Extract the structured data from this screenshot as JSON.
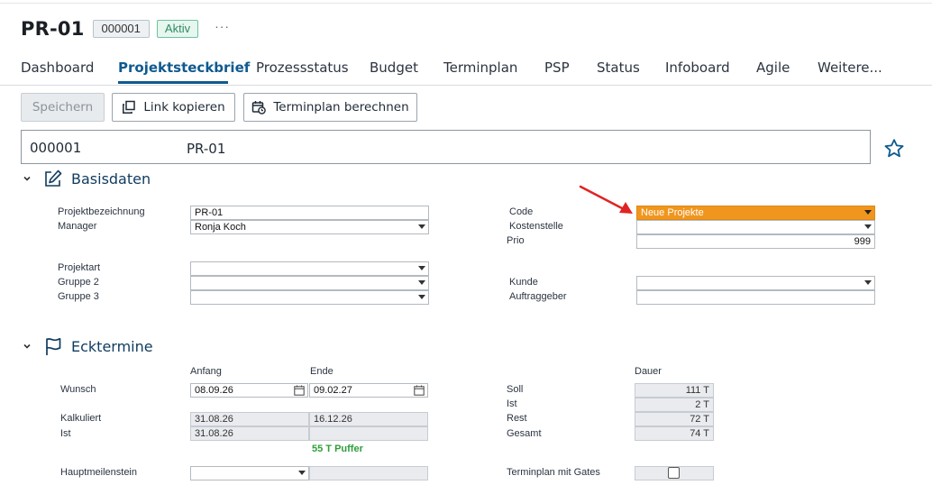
{
  "header": {
    "title": "PR-01",
    "id_badge": "000001",
    "status_badge": "Aktiv",
    "more": "···"
  },
  "tabs": [
    {
      "label": "Dashboard"
    },
    {
      "label": "Projektsteckbrief",
      "active": true
    },
    {
      "label": "Prozessstatus"
    },
    {
      "label": "Budget"
    },
    {
      "label": "Terminplan"
    },
    {
      "label": "PSP"
    },
    {
      "label": "Status"
    },
    {
      "label": "Infoboard"
    },
    {
      "label": "Agile"
    },
    {
      "label": "Weitere..."
    }
  ],
  "toolbar": {
    "save_label": "Speichern",
    "copy_link_label": "Link kopieren",
    "calc_schedule_label": "Terminplan berechnen"
  },
  "project": {
    "number": "000001",
    "name": "PR-01"
  },
  "basisdaten": {
    "title": "Basisdaten",
    "projektbezeichnung": {
      "label": "Projektbezeichnung",
      "value": "PR-01"
    },
    "manager": {
      "label": "Manager",
      "value": "Ronja Koch"
    },
    "projektart": {
      "label": "Projektart",
      "value": ""
    },
    "gruppe2": {
      "label": "Gruppe 2",
      "value": ""
    },
    "gruppe3": {
      "label": "Gruppe 3",
      "value": ""
    },
    "code": {
      "label": "Code",
      "value": "Neue Projekte"
    },
    "kostenstelle": {
      "label": "Kostenstelle",
      "value": ""
    },
    "prio": {
      "label": "Prio",
      "value": "999"
    },
    "kunde": {
      "label": "Kunde",
      "value": ""
    },
    "auftraggeber": {
      "label": "Auftraggeber",
      "value": ""
    }
  },
  "ecktermine": {
    "title": "Ecktermine",
    "col_anfang": "Anfang",
    "col_ende": "Ende",
    "col_dauer": "Dauer",
    "wunsch": {
      "label": "Wunsch",
      "anfang": "08.09.26",
      "ende": "09.02.27"
    },
    "kalkuliert": {
      "label": "Kalkuliert",
      "anfang": "31.08.26",
      "ende": "16.12.26"
    },
    "ist": {
      "label": "Ist",
      "anfang": "31.08.26",
      "ende": ""
    },
    "puffer": "55 T Puffer",
    "hauptmeilenstein": {
      "label": "Hauptmeilenstein",
      "value": ""
    },
    "soll": {
      "label": "Soll",
      "value": "111 T"
    },
    "ist_dauer": {
      "label": "Ist",
      "value": "2 T"
    },
    "rest": {
      "label": "Rest",
      "value": "72 T"
    },
    "gesamt": {
      "label": "Gesamt",
      "value": "74 T"
    },
    "gates": {
      "label": "Terminplan mit Gates",
      "checked": false
    }
  },
  "colors": {
    "accent": "#0f5a8f",
    "code_highlight": "#f0961e",
    "status_green": "#2d8b66",
    "puffer_green": "#2e9e3a",
    "annotation_arrow": "#e02424"
  }
}
